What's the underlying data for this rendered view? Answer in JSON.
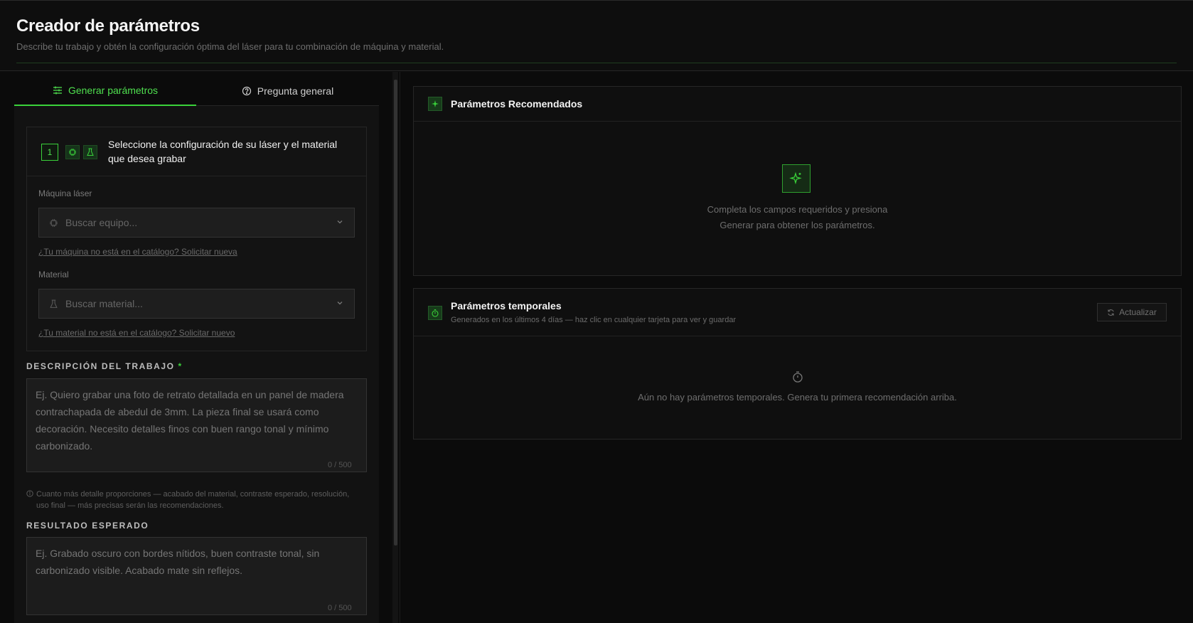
{
  "header": {
    "title": "Creador de parámetros",
    "subtitle": "Describe tu trabajo y obtén la configuración óptima del láser para tu combinación de máquina y material."
  },
  "tabs": [
    {
      "label": "Generar parámetros",
      "icon": "sliders-icon",
      "active": true
    },
    {
      "label": "Pregunta general",
      "icon": "help-circle-icon",
      "active": false
    }
  ],
  "config": {
    "step": "1",
    "title": "Seleccione la configuración de su láser y el material que desea grabar",
    "machine_label": "Máquina láser",
    "machine_placeholder": "Buscar equipo...",
    "machine_link": "¿Tu máquina no está en el catálogo? Solicitar nueva",
    "material_label": "Material",
    "material_placeholder": "Buscar material...",
    "material_link": "¿Tu material no está en el catálogo? Solicitar nuevo"
  },
  "description": {
    "label": "DESCRIPCIÓN DEL TRABAJO",
    "required_mark": "*",
    "placeholder": "Ej. Quiero grabar una foto de retrato detallada en un panel de madera contrachapada de abedul de 3mm. La pieza final se usará como decoración. Necesito detalles finos con buen rango tonal y mínimo carbonizado.",
    "counter": "0 / 500",
    "hint": "Cuanto más detalle proporciones — acabado del material, contraste esperado, resolución, uso final — más precisas serán las recomendaciones."
  },
  "result": {
    "label": "RESULTADO ESPERADO",
    "placeholder": "Ej. Grabado oscuro con bordes nítidos, buen contraste tonal, sin carbonizado visible. Acabado mate sin reflejos.",
    "counter": "0 / 500"
  },
  "recommended": {
    "title": "Parámetros Recomendados",
    "empty_line1": "Completa los campos requeridos y presiona",
    "empty_line2": "Generar para obtener los parámetros."
  },
  "temporal": {
    "title": "Parámetros temporales",
    "subtitle": "Generados en los últimos 4 días — haz clic en cualquier tarjeta para ver y guardar",
    "refresh_label": "Actualizar",
    "empty": "Aún no hay parámetros temporales. Genera tu primera recomendación arriba."
  },
  "colors": {
    "accent": "#3ad13a",
    "background": "#0b0b0b",
    "panel": "#121212"
  }
}
